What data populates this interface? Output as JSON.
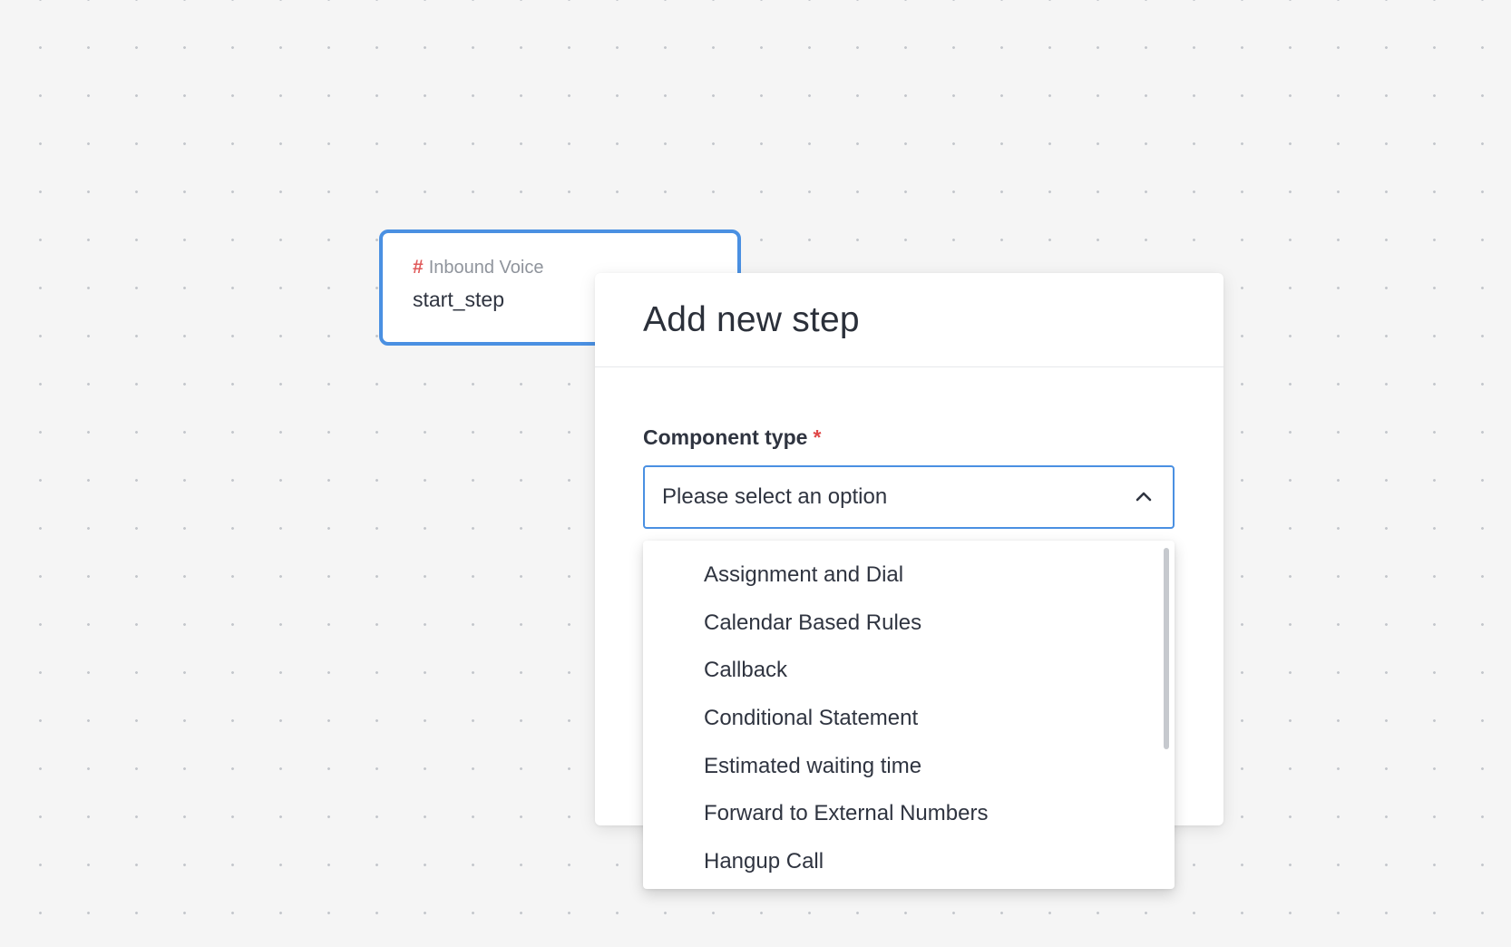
{
  "node": {
    "type_label": "Inbound Voice",
    "name": "start_step"
  },
  "modal": {
    "title": "Add new step",
    "field": {
      "label": "Component type",
      "required_mark": "*",
      "placeholder": "Please select an option"
    },
    "options": [
      "Assignment and Dial",
      "Calendar Based Rules",
      "Callback",
      "Conditional Statement",
      "Estimated waiting time",
      "Forward to External Numbers",
      "Hangup Call"
    ],
    "scroll_visible_fraction": 0.6,
    "scroll_position": 0
  },
  "icons": {
    "node_type": "hash-icon",
    "select_toggle": "chevron-up-icon"
  },
  "colors": {
    "accent": "#4a90e2",
    "required": "#e04848",
    "hash": "#e05a5a"
  }
}
